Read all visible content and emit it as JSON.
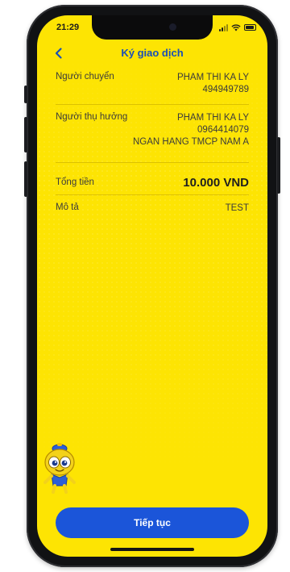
{
  "status_bar": {
    "time": "21:29"
  },
  "header": {
    "title": "Ký giao dịch",
    "back_icon": "chevron-left-icon"
  },
  "details": {
    "sender": {
      "label": "Người chuyển",
      "name": "PHAM THI KA LY",
      "account": "494949789"
    },
    "beneficiary": {
      "label": "Người thụ hưởng",
      "name": "PHAM THI KA LY",
      "account": "0964414079",
      "bank": "NGAN HANG TMCP NAM A"
    },
    "total": {
      "label": "Tổng tiền",
      "amount": "10.000 VND"
    },
    "description": {
      "label": "Mô tả",
      "value": "TEST"
    }
  },
  "actions": {
    "continue_label": "Tiếp tục"
  },
  "colors": {
    "background": "#fde403",
    "accent": "#1b55d9",
    "title": "#1a4fb8"
  }
}
